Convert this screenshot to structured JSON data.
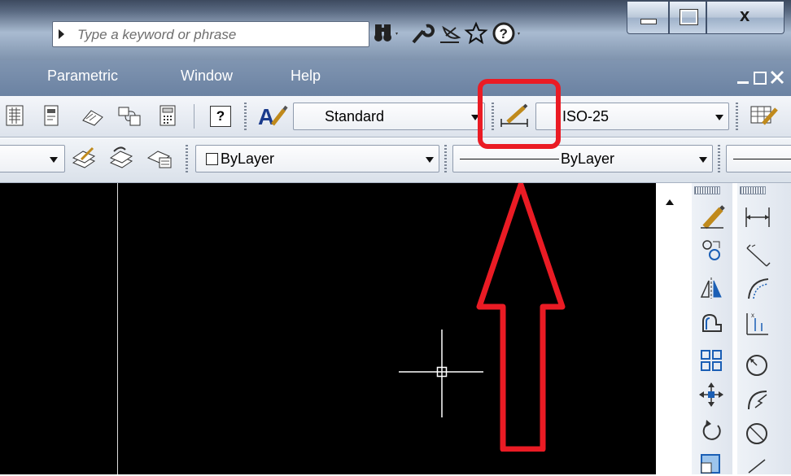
{
  "search": {
    "placeholder": "Type a keyword or phrase"
  },
  "title_icons": [
    "binoculars-icon",
    "wrench-icon",
    "satellite-dish-icon",
    "star-icon",
    "help-icon"
  ],
  "window_controls": [
    "minimize-button",
    "maximize-button",
    "close-button"
  ],
  "window_controls_labels": {
    "close": "x"
  },
  "menu": {
    "items": [
      "Parametric",
      "Window",
      "Help"
    ]
  },
  "toolbar1": {
    "text_style": "Standard",
    "dim_style": "ISO-25",
    "help_label": "?"
  },
  "toolbar2": {
    "color": "ByLayer",
    "linetype": "ByLayer"
  },
  "annotation": {
    "highlight_color": "#ea1b24"
  },
  "colors": {
    "canvas": "#000000",
    "crosshair": "#ffffff",
    "menubar": "#7088a8"
  }
}
